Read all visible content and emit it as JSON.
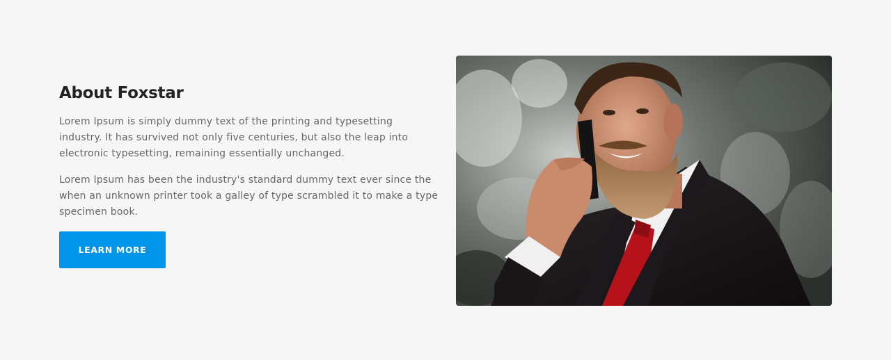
{
  "about": {
    "title": "About Foxstar",
    "paragraphs": [
      "Lorem Ipsum is simply dummy text of the printing and typesetting industry. It has survived not only five centuries, but also the leap into electronic typesetting, remaining essentially unchanged.",
      "Lorem Ipsum has been the industry's standard dummy text ever since the when an unknown printer took a galley of type scrambled it to make a type specimen book."
    ],
    "button_label": "LEARN MORE"
  },
  "image": {
    "subject": "bearded-man-on-phone-photo",
    "colors": {
      "accent": "#0095e8",
      "background": "#f6f6f6",
      "suit": "#1a1618",
      "tie": "#b5121b",
      "beard": "#a0724a"
    }
  }
}
